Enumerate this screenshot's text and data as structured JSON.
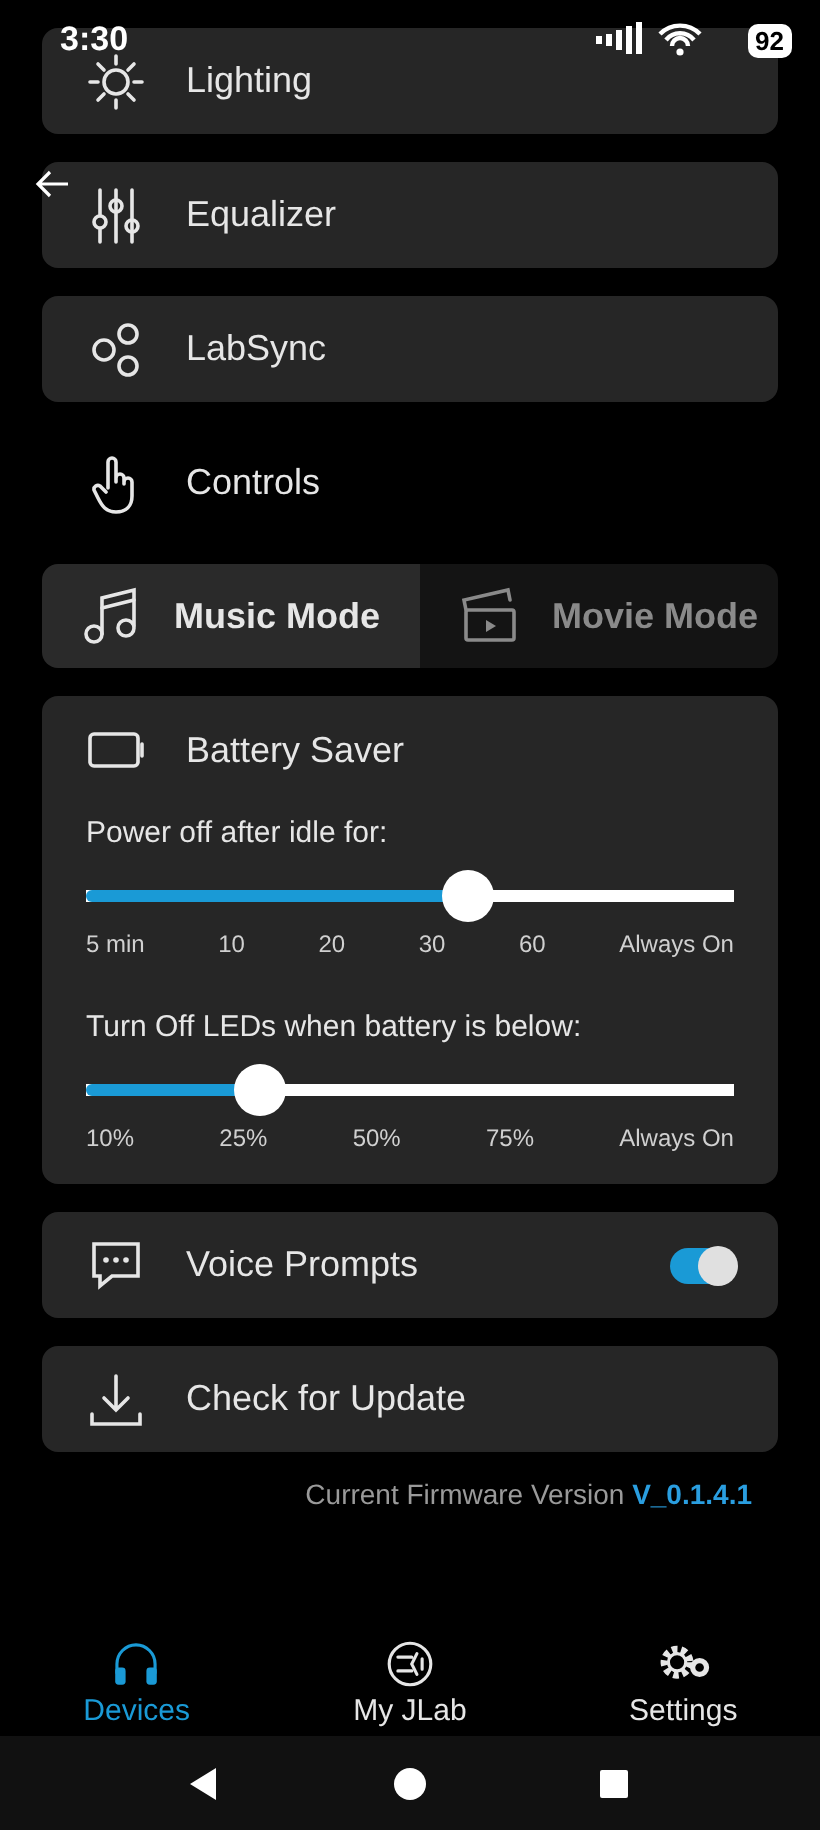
{
  "status_bar": {
    "time": "3:30",
    "battery": "92"
  },
  "menu": [
    {
      "label": "Lighting",
      "framed": true
    },
    {
      "label": "Equalizer",
      "framed": true
    },
    {
      "label": "LabSync",
      "framed": true
    },
    {
      "label": "Controls",
      "framed": false
    }
  ],
  "modes": [
    {
      "label": "Music Mode",
      "selected": true
    },
    {
      "label": "Movie Mode",
      "selected": false
    }
  ],
  "battery_saver": {
    "title": "Battery Saver",
    "sliders": [
      {
        "label": "Power off after idle for:",
        "level": 0.59,
        "ticks": [
          "5 min",
          "10",
          "20",
          "30",
          "60",
          "Always On"
        ]
      },
      {
        "label": "Turn Off LEDs when battery is below:",
        "level": 0.27,
        "ticks": [
          "10%",
          "25%",
          "50%",
          "75%",
          "Always On"
        ]
      }
    ]
  },
  "settings": [
    {
      "kind": "toggle",
      "label": "Voice Prompts",
      "on": true
    },
    {
      "kind": "button",
      "label": "Check for Update"
    }
  ],
  "firmware": {
    "label": "Current Firmware Version",
    "version": "V_0.1.4.1"
  },
  "bottom_nav": [
    {
      "label": "Devices",
      "selected": true
    },
    {
      "label": "My JLab",
      "selected": false
    },
    {
      "label": "Settings",
      "selected": false
    }
  ]
}
